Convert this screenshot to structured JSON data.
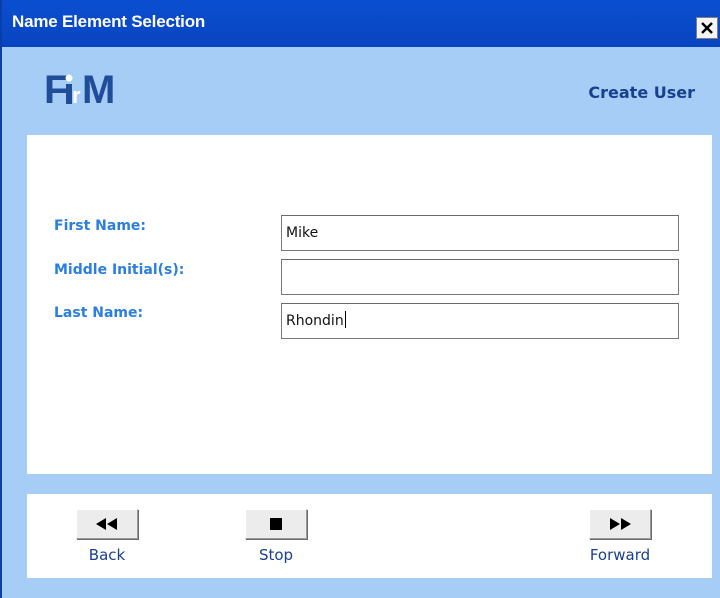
{
  "window": {
    "title": "Name Element Selection",
    "close_icon": "close-x-icon"
  },
  "header": {
    "logo_text": "FirM",
    "heading": "Create User"
  },
  "form": {
    "fields": [
      {
        "label": "First Name:",
        "value": "Mike"
      },
      {
        "label": "Middle Initial(s):",
        "value": ""
      },
      {
        "label": "Last Name:",
        "value": "Rhondin"
      }
    ]
  },
  "nav": {
    "back_label": "Back",
    "stop_label": "Stop",
    "forward_label": "Forward",
    "back_icon": "rewind-icon",
    "stop_icon": "stop-square-icon",
    "forward_icon": "fast-forward-icon"
  },
  "colors": {
    "title_bar": "#0a4fd0",
    "window_bg": "#a6cdf5",
    "label_blue": "#2a7fe0",
    "heading_navy": "#1a3f8f"
  }
}
